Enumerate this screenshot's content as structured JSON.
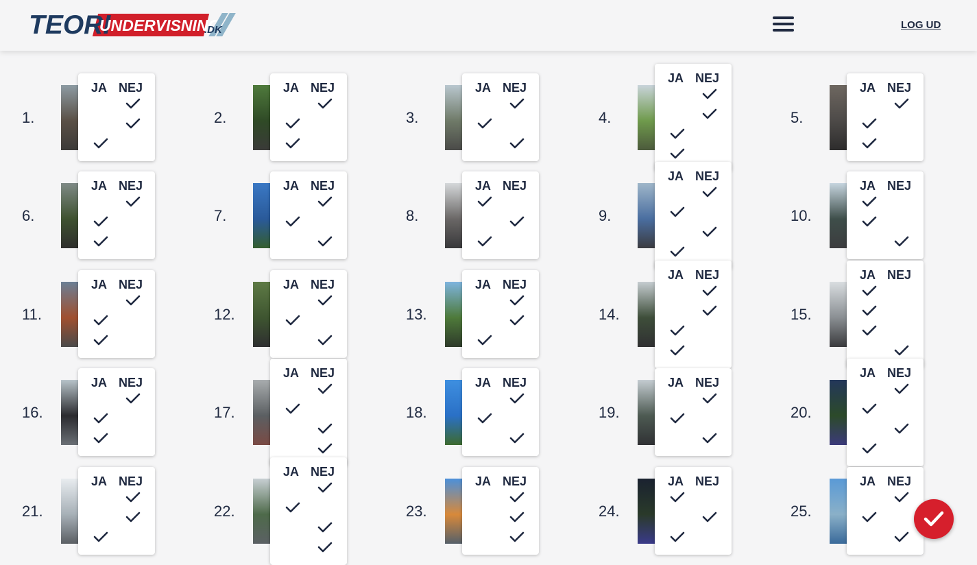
{
  "header": {
    "logo_teori": "TEORI",
    "logo_undervisning": "UNDERVISNING",
    "logo_dk": ".DK",
    "logout_label": "LOG UD"
  },
  "answer_labels": {
    "ja": "JA",
    "nej": "NEJ"
  },
  "colors": {
    "accent": "#d61f2c",
    "text": "#1f2940",
    "panel": "#ffffff"
  },
  "questions": [
    {
      "number": "1.",
      "answers": [
        "nej",
        "nej",
        "ja"
      ]
    },
    {
      "number": "2.",
      "answers": [
        "nej",
        "ja",
        "ja"
      ]
    },
    {
      "number": "3.",
      "answers": [
        "nej",
        "ja",
        "nej"
      ]
    },
    {
      "number": "4.",
      "answers": [
        "nej",
        "nej",
        "ja",
        "ja"
      ]
    },
    {
      "number": "5.",
      "answers": [
        "nej",
        "ja",
        "ja"
      ]
    },
    {
      "number": "6.",
      "answers": [
        "nej",
        "ja",
        "ja"
      ]
    },
    {
      "number": "7.",
      "answers": [
        "nej",
        "ja",
        "nej"
      ]
    },
    {
      "number": "8.",
      "answers": [
        "ja",
        "nej",
        "ja"
      ]
    },
    {
      "number": "9.",
      "answers": [
        "nej",
        "ja",
        "nej",
        "ja"
      ]
    },
    {
      "number": "10.",
      "answers": [
        "ja",
        "ja",
        "nej"
      ]
    },
    {
      "number": "11.",
      "answers": [
        "nej",
        "ja",
        "ja"
      ]
    },
    {
      "number": "12.",
      "answers": [
        "nej",
        "ja",
        "nej"
      ]
    },
    {
      "number": "13.",
      "answers": [
        "nej",
        "nej",
        "ja"
      ]
    },
    {
      "number": "14.",
      "answers": [
        "nej",
        "nej",
        "ja",
        "ja"
      ]
    },
    {
      "number": "15.",
      "answers": [
        "ja",
        "ja",
        "ja",
        "nej"
      ]
    },
    {
      "number": "16.",
      "answers": [
        "nej",
        "ja",
        "ja"
      ]
    },
    {
      "number": "17.",
      "answers": [
        "nej",
        "ja",
        "nej",
        "nej"
      ]
    },
    {
      "number": "18.",
      "answers": [
        "nej",
        "ja",
        "nej"
      ]
    },
    {
      "number": "19.",
      "answers": [
        "nej",
        "ja",
        "nej"
      ]
    },
    {
      "number": "20.",
      "answers": [
        "nej",
        "ja",
        "nej",
        "ja"
      ]
    },
    {
      "number": "21.",
      "answers": [
        "nej",
        "nej",
        "ja"
      ]
    },
    {
      "number": "22.",
      "answers": [
        "nej",
        "ja",
        "nej",
        "nej"
      ]
    },
    {
      "number": "23.",
      "answers": [
        "nej",
        "nej",
        "nej"
      ]
    },
    {
      "number": "24.",
      "answers": [
        "ja",
        "nej",
        "ja"
      ]
    },
    {
      "number": "25.",
      "answers": [
        "nej",
        "ja",
        "nej"
      ]
    }
  ]
}
